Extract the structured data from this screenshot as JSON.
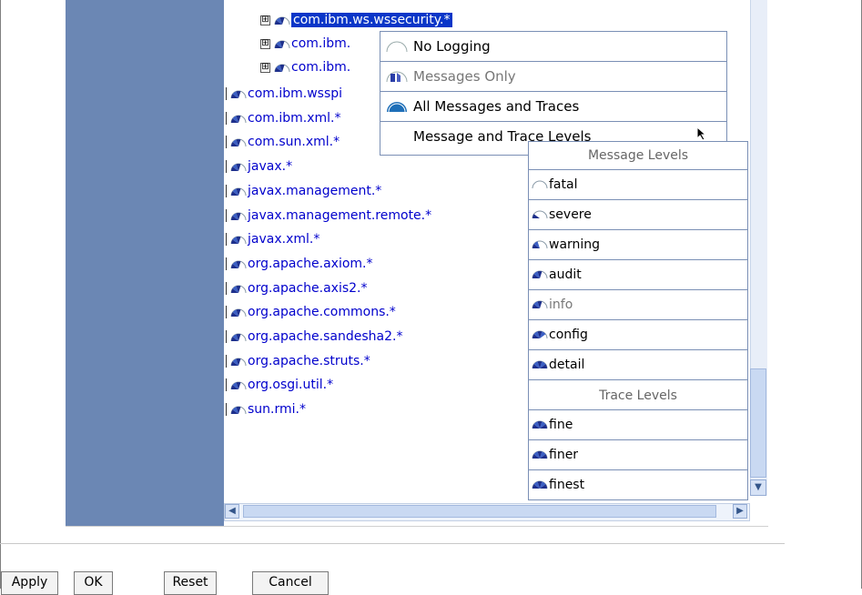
{
  "tree": {
    "rows": [
      {
        "label": "com.ibm.ws.wssecurity.*",
        "expander": "⊞",
        "selected": true
      },
      {
        "label": "com.ibm.",
        "expander": "⊞"
      },
      {
        "label": "com.ibm.",
        "expander": "⊞"
      },
      {
        "label": "com.ibm.wsspi"
      },
      {
        "label": "com.ibm.xml.*"
      },
      {
        "label": "com.sun.xml.*"
      },
      {
        "label": "javax.*"
      },
      {
        "label": "javax.management.*"
      },
      {
        "label": "javax.management.remote.*"
      },
      {
        "label": "javax.xml.*"
      },
      {
        "label": "org.apache.axiom.*"
      },
      {
        "label": "org.apache.axis2.*"
      },
      {
        "label": "org.apache.commons.*"
      },
      {
        "label": "org.apache.sandesha2.*"
      },
      {
        "label": "org.apache.struts.*"
      },
      {
        "label": "org.osgi.util.*"
      },
      {
        "label": "sun.rmi.*"
      }
    ]
  },
  "menu": {
    "items": [
      {
        "label": "No Logging"
      },
      {
        "label": "Messages Only",
        "disabled": true
      },
      {
        "label": "All Messages and Traces"
      },
      {
        "label": "Message and Trace Levels"
      }
    ]
  },
  "submenu": {
    "message_heading": "Message Levels",
    "message_levels": [
      "fatal",
      "severe",
      "warning",
      "audit",
      "info",
      "config",
      "detail"
    ],
    "trace_heading": "Trace Levels",
    "trace_levels": [
      "fine",
      "finer",
      "finest"
    ]
  },
  "buttons": {
    "apply": "Apply",
    "ok": "OK",
    "reset": "Reset",
    "cancel": "Cancel"
  },
  "colors": {
    "panel_blue": "#6b87b4",
    "link_blue": "#0000cc",
    "selection": "#0a36c8"
  }
}
